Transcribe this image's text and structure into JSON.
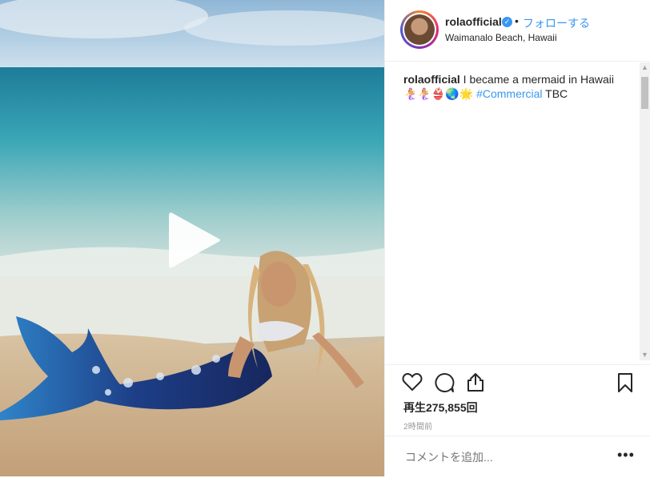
{
  "post": {
    "username": "rolaofficial",
    "separator": "•",
    "follow_label": "フォローする",
    "location": "Waimanalo Beach, Hawaii",
    "caption_user": "rolaofficial",
    "caption_text": " I became a mermaid in Hawaii",
    "caption_emoji": "🧜‍♀️🧜‍♀️👙🌏🌟",
    "caption_tag": "#Commercial",
    "caption_end": " TBC",
    "views": "再生275,855回",
    "time": "2時間前",
    "comment_placeholder": "コメントを追加...",
    "more_label": "•••"
  },
  "icons": [
    "play-icon",
    "heart-icon",
    "comment-icon",
    "share-icon",
    "bookmark-icon",
    "verified-badge-icon",
    "scroll-up-icon",
    "scroll-down-icon"
  ],
  "colors": {
    "accent": "#3897f0",
    "text": "#262626",
    "muted": "#999999"
  }
}
